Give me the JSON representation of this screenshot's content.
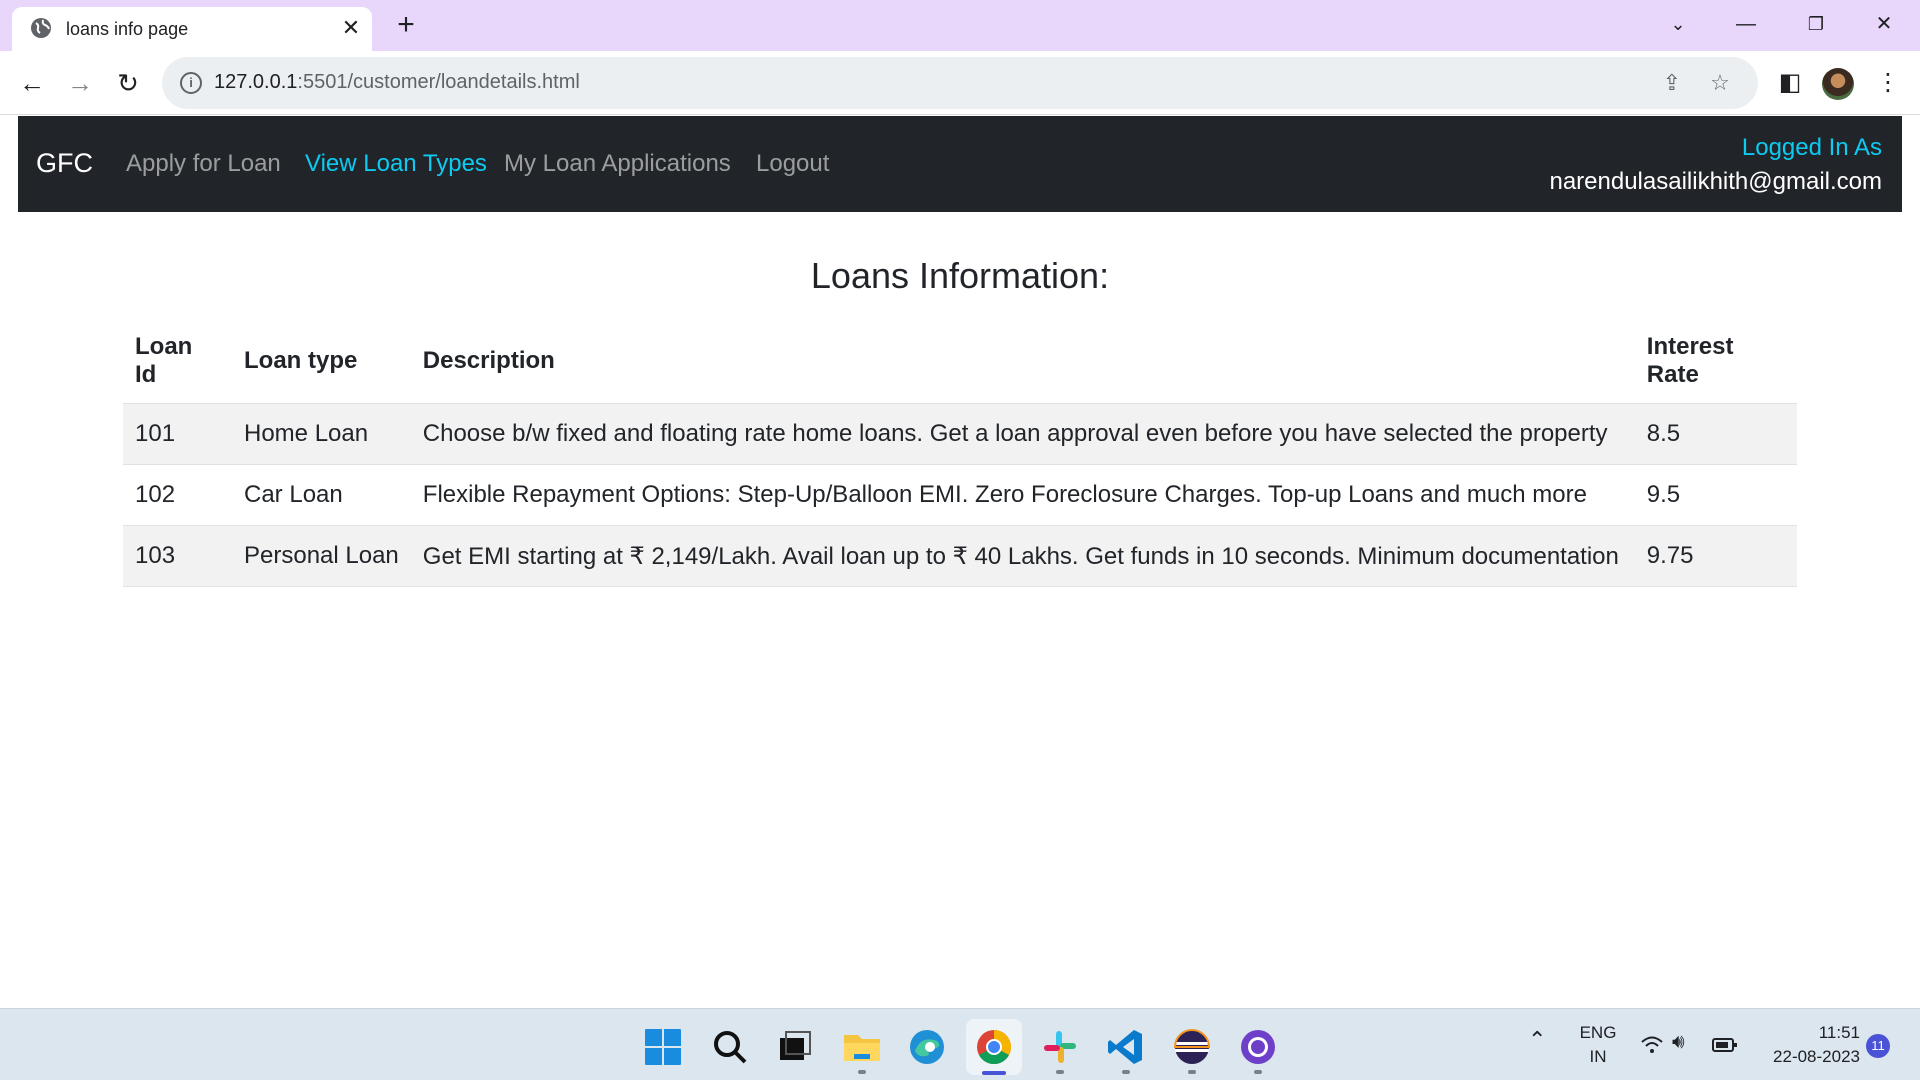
{
  "browser": {
    "tab_title": "loans info page",
    "url_host": "127.0.0.1",
    "url_path": ":5501/customer/loandetails.html"
  },
  "navbar": {
    "brand": "GFC",
    "links": [
      {
        "label": "Apply for Loan",
        "active": false
      },
      {
        "label": "View Loan Types",
        "active": true
      },
      {
        "label": "My Loan Applications",
        "active": false
      },
      {
        "label": "Logout",
        "active": false
      }
    ],
    "logged_in_label": "Logged In As",
    "logged_in_email": "narendulasailikhith@gmail.com",
    "accent_color": "#0dcaf0",
    "background_color": "#212529"
  },
  "page": {
    "heading": "Loans Information:"
  },
  "table": {
    "headers": [
      "Loan Id",
      "Loan type",
      "Description",
      "Interest Rate"
    ],
    "rows": [
      [
        "101",
        "Home Loan",
        "Choose b/w fixed and floating rate home loans. Get a loan approval even before you have selected the property",
        "8.5"
      ],
      [
        "102",
        "Car Loan",
        "Flexible Repayment Options: Step-Up/Balloon EMI. Zero Foreclosure Charges. Top-up Loans and much more",
        "9.5"
      ],
      [
        "103",
        "Personal Loan",
        "Get EMI starting at ₹ 2,149/Lakh. Avail loan up to ₹ 40 Lakhs. Get funds in 10 seconds. Minimum documentation",
        "9.75"
      ]
    ]
  },
  "taskbar": {
    "lang_line1": "ENG",
    "lang_line2": "IN",
    "time": "11:51",
    "date": "22-08-2023",
    "notification_count": "11",
    "apps": [
      "windows-start",
      "search",
      "task-view",
      "file-explorer",
      "edge",
      "chrome",
      "slack",
      "vscode",
      "eclipse",
      "github-desktop"
    ]
  }
}
